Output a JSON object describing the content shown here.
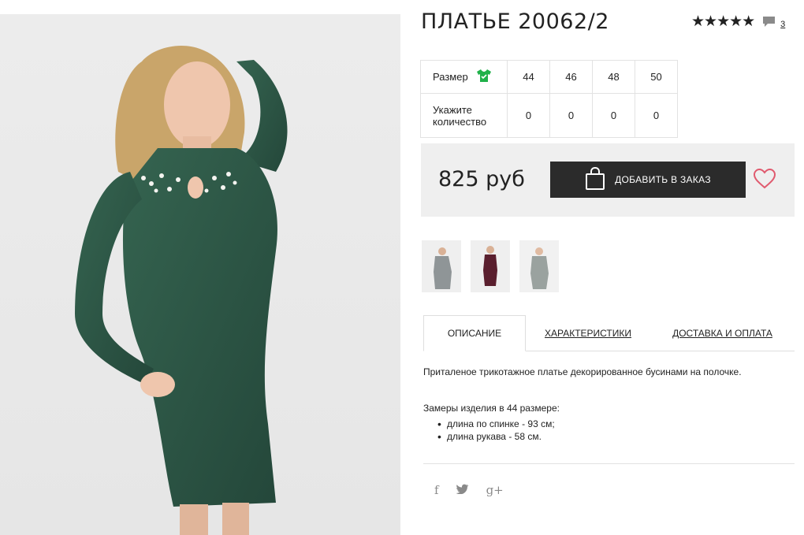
{
  "product": {
    "title": "ПЛАТЬЕ 20062/2",
    "stars": "★★★★★",
    "review_count": "3"
  },
  "size_table": {
    "size_label": "Размер",
    "qty_label": "Укажите количество",
    "sizes": [
      "44",
      "46",
      "48",
      "50"
    ],
    "quantities": [
      "0",
      "0",
      "0",
      "0"
    ]
  },
  "purchase": {
    "price": "825 руб",
    "add_button": "ДОБАВИТЬ В ЗАКАЗ"
  },
  "thumbnails": [
    {
      "color": "#8f9597",
      "icon": "dress-gray"
    },
    {
      "color": "#5a1f2e",
      "icon": "dress-burgundy"
    },
    {
      "color": "#9aa29f",
      "icon": "dress-light"
    }
  ],
  "tabs": [
    {
      "label": "ОПИСАНИЕ"
    },
    {
      "label": "ХАРАКТЕРИСТИКИ"
    },
    {
      "label": "ДОСТАВКА И ОПЛАТА"
    }
  ],
  "description": {
    "intro": "Приталеное трикотажное платье декорированное бусинами на полочке.",
    "measure_title": "Замеры изделия в 44 размере:",
    "items": [
      "длина по спинке - 93 см;",
      "длина рукава - 58 см."
    ]
  },
  "social": {
    "facebook": "f",
    "twitter": "t",
    "gplus": "g+"
  },
  "colors": {
    "dress": "#2f5a47",
    "button": "#2b2b2b",
    "heart": "#e05a6e",
    "shirt": "#20b14a"
  }
}
